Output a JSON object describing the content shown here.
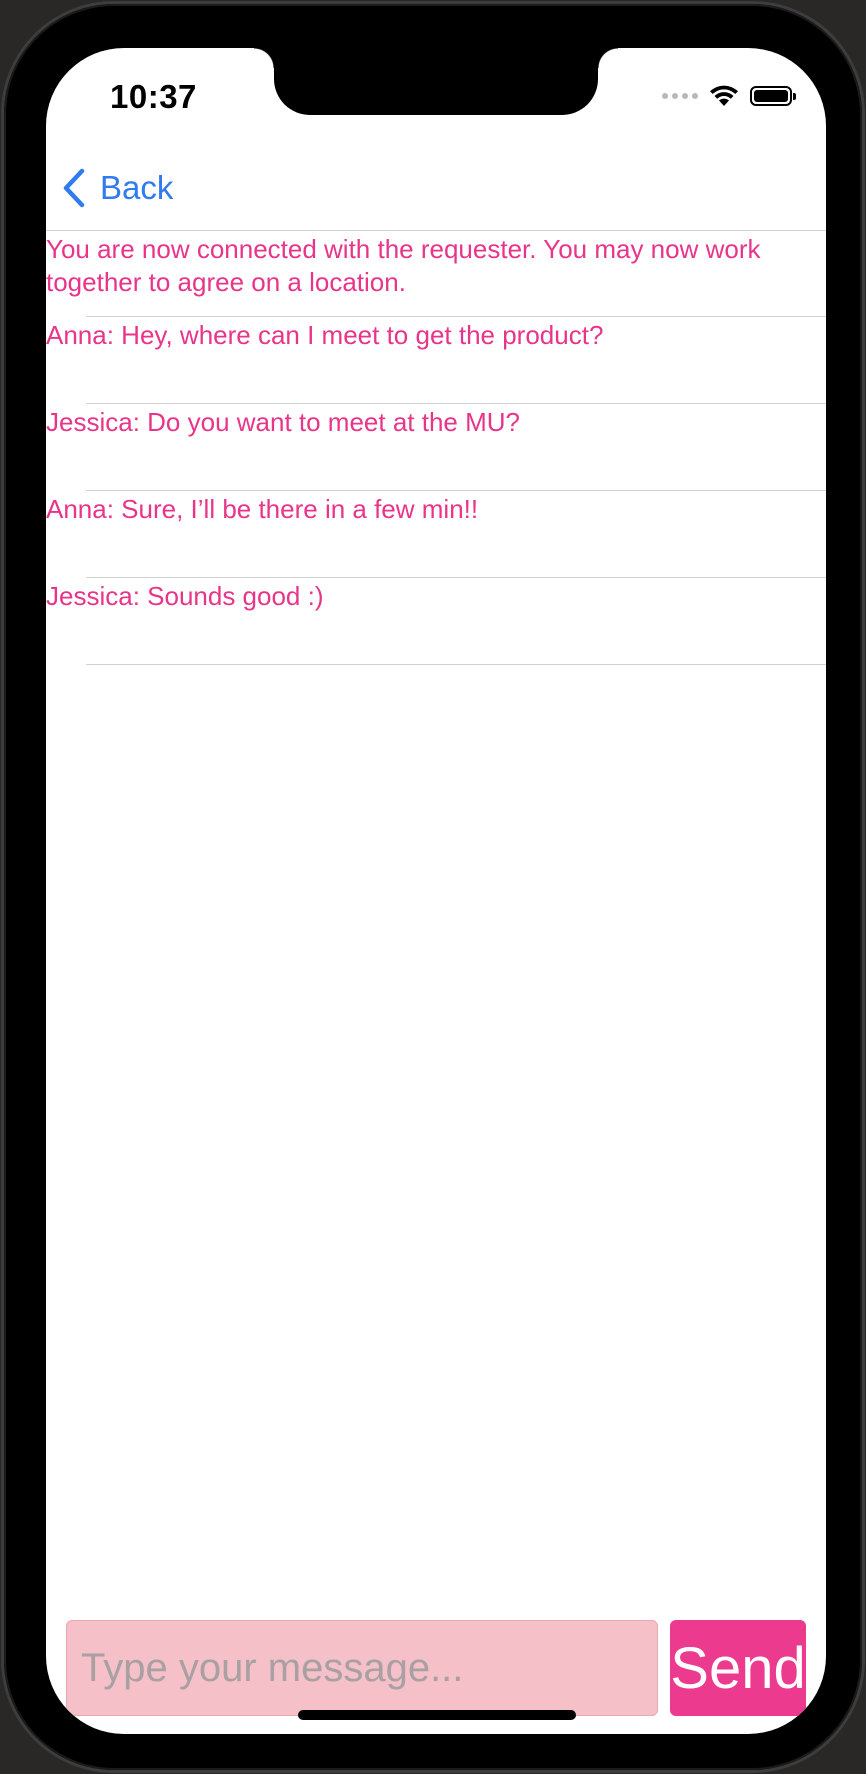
{
  "status_bar": {
    "time": "10:37"
  },
  "nav": {
    "back_label": "Back",
    "accent_color": "#2f7bef"
  },
  "chat": {
    "text_color": "#e8358a",
    "messages": [
      "You are now connected with the requester. You may now work together to agree on a location.",
      "Anna: Hey, where can I meet to get the product?",
      "Jessica: Do you want to meet at the MU?",
      "Anna: Sure, I’ll be there in a few min!!",
      "Jessica: Sounds good :)"
    ]
  },
  "composer": {
    "input_value": "",
    "input_placeholder": "Type your message...",
    "send_label": "Send",
    "input_bg_color": "#f5c0c8",
    "send_bg_color": "#ec3a8f"
  }
}
